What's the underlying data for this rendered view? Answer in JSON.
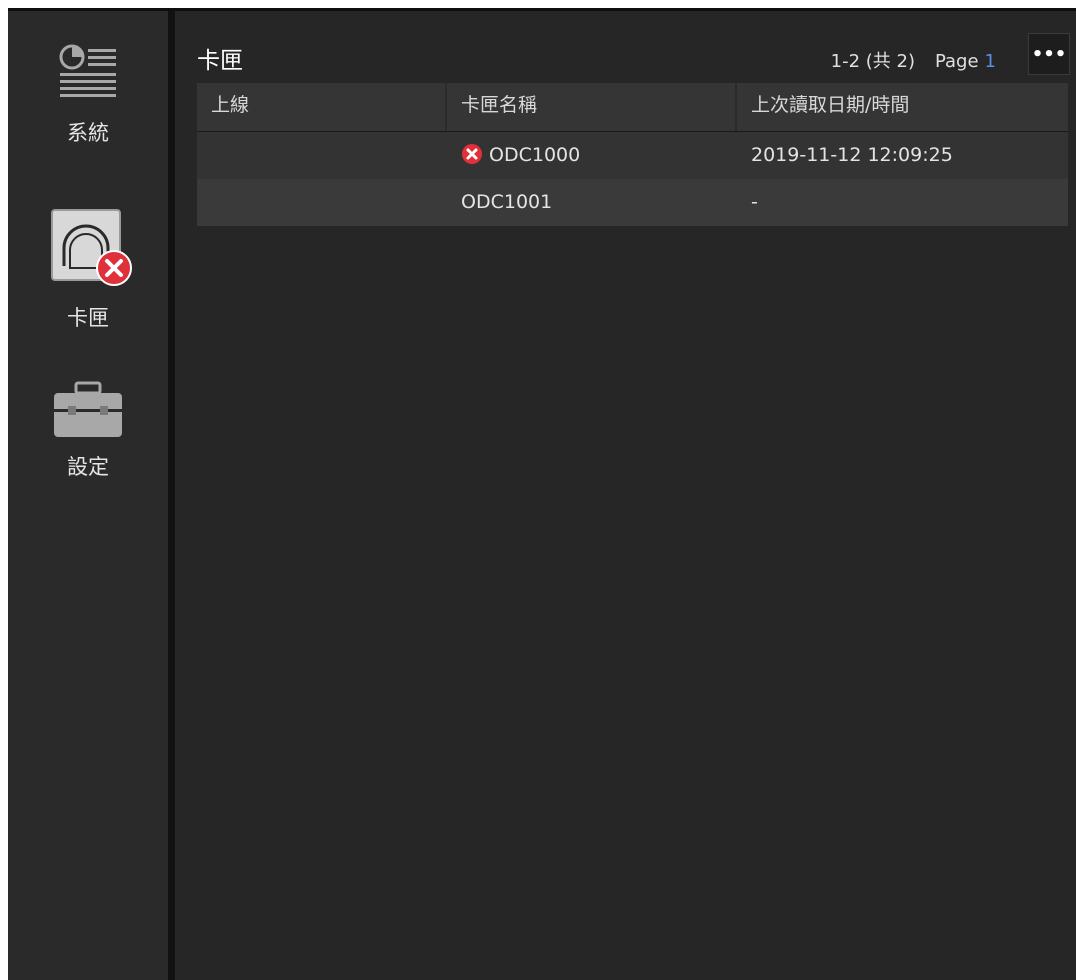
{
  "sidebar": {
    "items": [
      {
        "label": "系統",
        "icon": "system-list-icon"
      },
      {
        "label": "卡匣",
        "icon": "cartridge-error-icon"
      },
      {
        "label": "設定",
        "icon": "toolbox-icon"
      }
    ]
  },
  "header": {
    "title": "卡匣",
    "range": "1-2 (共 2)",
    "page_label": "Page",
    "page_number": "1",
    "more_label": "•••"
  },
  "table": {
    "columns": [
      "上線",
      "卡匣名稱",
      "上次讀取日期/時間"
    ],
    "rows": [
      {
        "online": "",
        "name": "ODC1000",
        "last_read": "2019-11-12 12:09:25",
        "status_icon": "error-icon"
      },
      {
        "online": "",
        "name": "ODC1001",
        "last_read": "-",
        "status_icon": ""
      }
    ]
  },
  "colors": {
    "background": "#262626",
    "sidebar": "#2a2a2a",
    "error_red": "#e0303a",
    "page_number_blue": "#5b8ee6"
  }
}
